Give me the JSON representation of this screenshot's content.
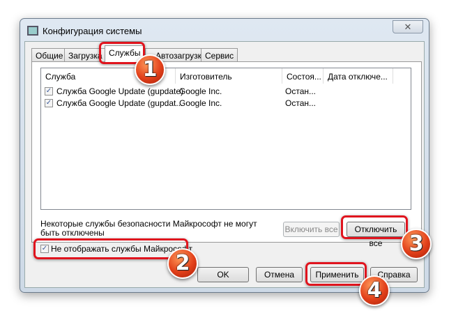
{
  "window": {
    "title": "Конфигурация системы",
    "close": "✕"
  },
  "tabs": [
    "Общие",
    "Загрузка",
    "Службы",
    "Автозагрузка",
    "Сервис"
  ],
  "columns": [
    "Служба",
    "Изготовитель",
    "Состоя...",
    "Дата отключе..."
  ],
  "rows": [
    {
      "checked": true,
      "name": "Служба Google Update (gupdate)",
      "vendor": "Google Inc.",
      "state": "Остан..."
    },
    {
      "checked": true,
      "name": "Служба Google Update (gupdat...",
      "vendor": "Google Inc.",
      "state": "Остан..."
    }
  ],
  "note": "Некоторые службы безопасности Майкрософт не могут быть отключены",
  "buttons": {
    "enable_all": "Включить все",
    "disable_all": "Отключить все",
    "ok": "OK",
    "cancel": "Отмена",
    "apply": "Применить",
    "help": "Справка"
  },
  "hide_ms": {
    "checked": true,
    "label": "Не отображать службы Майкрософт"
  },
  "badges": [
    "1",
    "2",
    "3",
    "4"
  ]
}
